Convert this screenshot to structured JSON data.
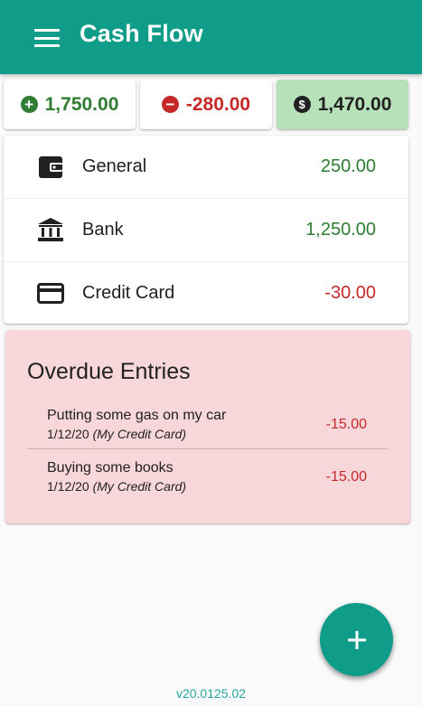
{
  "app": {
    "title": "Cash Flow"
  },
  "summary": {
    "income": "1,750.00",
    "expense": "-280.00",
    "balance": "1,470.00"
  },
  "accounts": [
    {
      "name": "General",
      "value": "250.00",
      "icon": "wallet-icon"
    },
    {
      "name": "Bank",
      "value": "1,250.00",
      "icon": "bank-icon"
    },
    {
      "name": "Credit Card",
      "value": "-30.00",
      "icon": "credit-card-icon"
    }
  ],
  "overdue": {
    "title": "Overdue Entries",
    "entries": [
      {
        "description": "Putting some gas on my car",
        "date": "1/12/20",
        "account": "(My Credit Card)",
        "amount": "-15.00"
      },
      {
        "description": "Buying some books",
        "date": "1/12/20",
        "account": "(My Credit Card)",
        "amount": "-15.00"
      }
    ]
  },
  "fab": {
    "icon": "plus-icon"
  },
  "footer": {
    "version": "v20.0125.02"
  },
  "colors": {
    "primary": "#0f9d8a",
    "positive": "#2e7d32",
    "negative": "#c62828",
    "balance_bg": "#b7e2b9",
    "overdue_bg": "#f8d7da"
  }
}
